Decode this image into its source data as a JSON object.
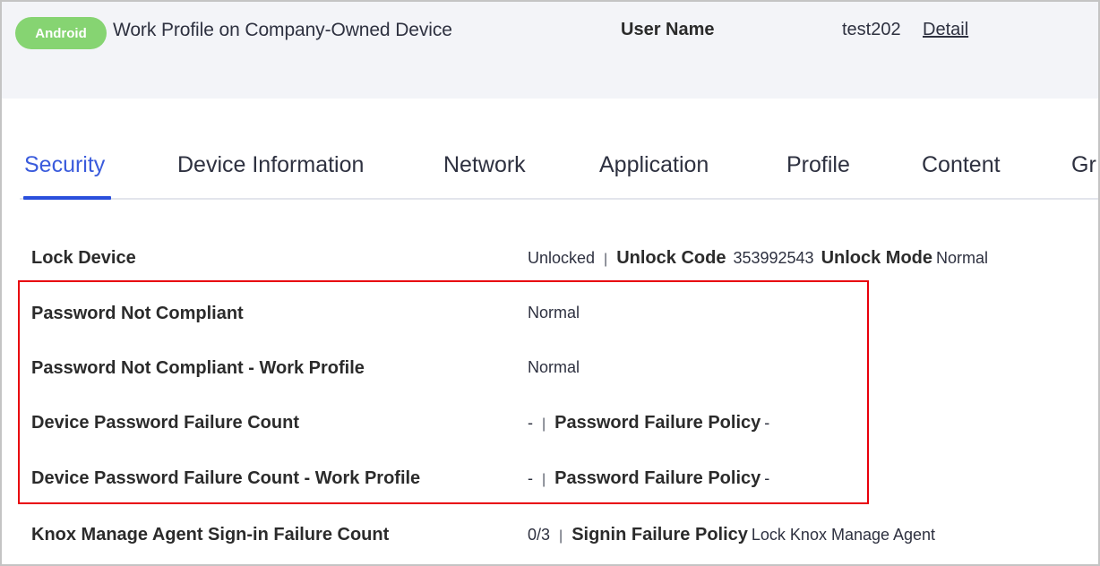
{
  "header": {
    "platform_badge": "Android",
    "device_type": "Work Profile on Company-Owned Device",
    "user_label": "User Name",
    "user_value": "test202",
    "detail_link": "Detail"
  },
  "tabs": [
    {
      "label": "Security",
      "active": true
    },
    {
      "label": "Device Information",
      "active": false
    },
    {
      "label": "Network",
      "active": false
    },
    {
      "label": "Application",
      "active": false
    },
    {
      "label": "Profile",
      "active": false
    },
    {
      "label": "Content",
      "active": false
    },
    {
      "label": "Gr",
      "active": false
    }
  ],
  "security": {
    "lock_device": {
      "label": "Lock Device",
      "status": "Unlocked",
      "separator": "|",
      "unlock_code_label": "Unlock Code",
      "unlock_code": "353992543",
      "unlock_mode_label": "Unlock Mode",
      "unlock_mode": "Normal"
    },
    "password_not_compliant": {
      "label": "Password Not Compliant",
      "value": "Normal"
    },
    "password_not_compliant_wp": {
      "label": "Password Not Compliant - Work Profile",
      "value": "Normal"
    },
    "device_password_failure": {
      "label": "Device Password Failure Count",
      "count": "-",
      "separator": "|",
      "policy_label": "Password Failure Policy",
      "policy_value": "-"
    },
    "device_password_failure_wp": {
      "label": "Device Password Failure Count - Work Profile",
      "count": "-",
      "separator": "|",
      "policy_label": "Password Failure Policy",
      "policy_value": "-"
    },
    "agent_signin_failure": {
      "label": "Knox Manage Agent Sign-in Failure Count",
      "count": "0/3",
      "separator": "|",
      "policy_label": "Signin Failure Policy",
      "policy_value": "Lock Knox Manage Agent"
    }
  },
  "colors": {
    "badge": "#86d472",
    "active_tab": "#3a5bdc",
    "highlight_box": "#e8000b"
  }
}
